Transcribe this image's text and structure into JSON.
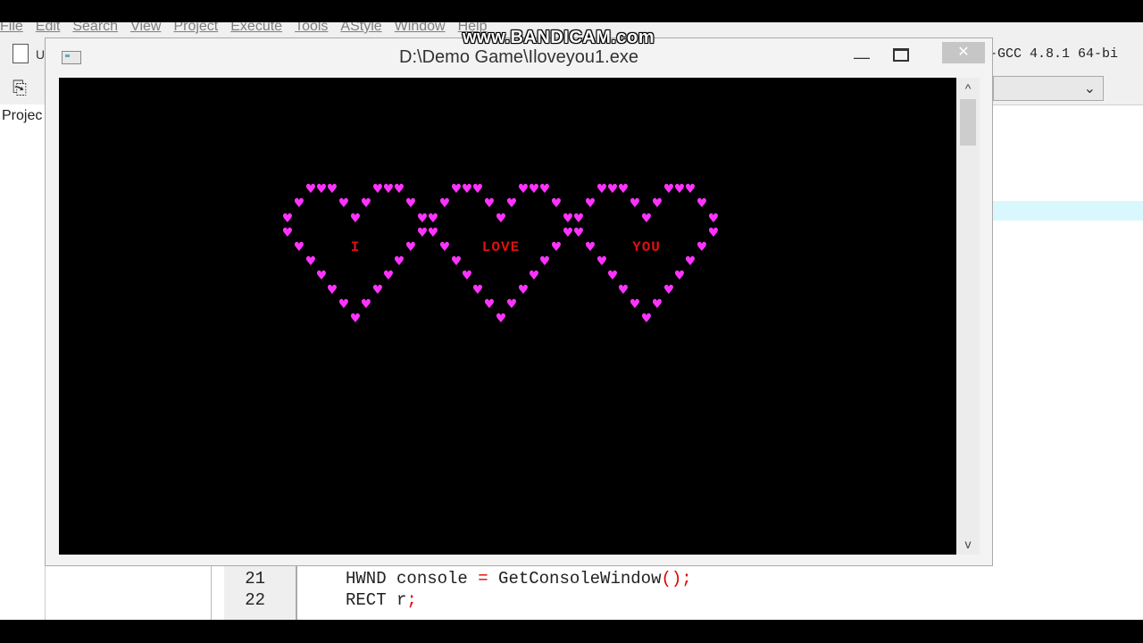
{
  "ide": {
    "menu": [
      "File",
      "Edit",
      "Search",
      "View",
      "Project",
      "Execute",
      "Tools",
      "AStyle",
      "Window",
      "Help"
    ],
    "toolbar_partial_text": "U",
    "compiler": "-GCC 4.8.1 64-bi",
    "project_tab": "Projec",
    "code": {
      "lines": [
        {
          "num": "21",
          "text_a": "HWND console ",
          "op": "=",
          "text_b": " GetConsoleWindow",
          "end": "();"
        },
        {
          "num": "22",
          "text_a": "RECT r",
          "op": "",
          "text_b": "",
          "end": ";"
        }
      ]
    }
  },
  "console": {
    "title": "D:\\Demo Game\\Iloveyou1.exe",
    "minimize_glyph": "—",
    "close_glyph": "✕",
    "hearts": [
      {
        "word": "I"
      },
      {
        "word": "LOVE"
      },
      {
        "word": "YOU"
      }
    ],
    "heart_color": "#ff33ff",
    "word_color": "#e01010"
  },
  "watermark": "www.BANDICAM.com",
  "icons": [
    "new-file-icon",
    "paste-icon",
    "console-app-icon",
    "minimize-icon",
    "maximize-icon",
    "close-icon",
    "scroll-up-icon",
    "scroll-down-icon",
    "heart-icon"
  ]
}
